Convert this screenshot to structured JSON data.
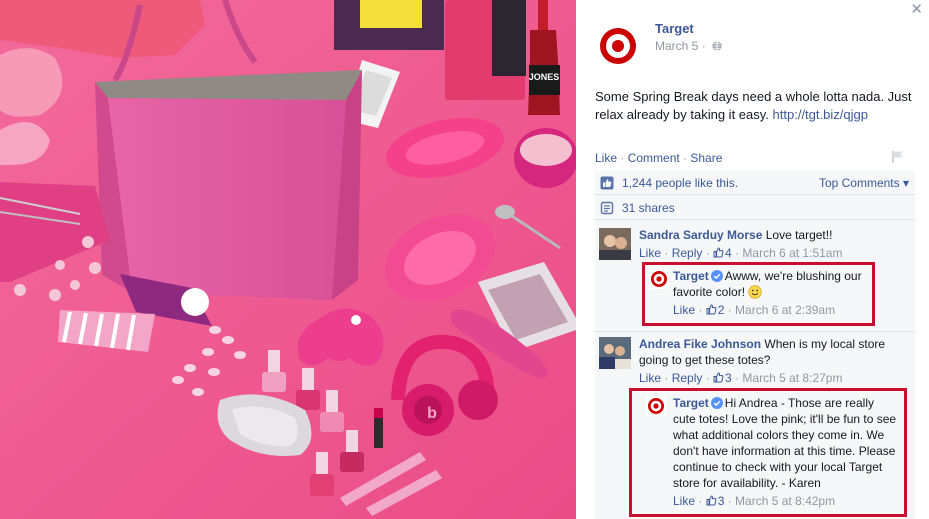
{
  "post": {
    "page_name": "Target",
    "date": "March 5",
    "separator": " · ",
    "text": "Some Spring Break days need a whole lotta nada. Just relax already by taking it easy.",
    "link": "http://tgt.biz/qjgp"
  },
  "actions": {
    "like": "Like",
    "comment": "Comment",
    "share": "Share",
    "sep": " · "
  },
  "likes": {
    "text": "1,244 people like this.",
    "top_comments": "Top Comments ▾"
  },
  "shares": {
    "text": "31 shares"
  },
  "comments": [
    {
      "author": "Sandra Sarduy Morse",
      "text": "Love target!!",
      "like": "Like",
      "reply": "Reply",
      "likes": "4",
      "time": "March 6 at 1:51am"
    },
    {
      "author": "Andrea Fike Johnson",
      "text": "When is my local store going to get these totes?",
      "like": "Like",
      "reply": "Reply",
      "likes": "3",
      "time": "March 5 at 8:27pm"
    }
  ],
  "replies": [
    {
      "author": "Target",
      "text": "Awww, we're blushing our favorite color!",
      "like": "Like",
      "likes": "2",
      "time": "March 6 at 2:39am"
    },
    {
      "author": "Target",
      "text": "Hi Andrea - Those are really cute totes! Love the pink; it'll be fun to see what additional colors they come in. We don't have information at this time. Please continue to check with your local Target store for availability. - Karen",
      "like": "Like",
      "likes": "3",
      "time": "March 5 at 8:42pm"
    }
  ],
  "photo_labels": {
    "jones": "JONES",
    "beats": "b"
  },
  "colors": {
    "background_pink": "#f0588f",
    "facebook_blue": "#3b5998",
    "target_red": "#cc0000",
    "highlight_red": "#c8102e",
    "meta_gray": "#9197a3",
    "ufi_background": "#f6f7f8"
  },
  "icons": {
    "close": "close-icon",
    "globe": "globe-icon",
    "flag": "flag-icon",
    "like": "thumbs-up-icon",
    "share": "share-icon",
    "verified": "verified-badge-icon",
    "smile": "smile-emoji-icon"
  }
}
